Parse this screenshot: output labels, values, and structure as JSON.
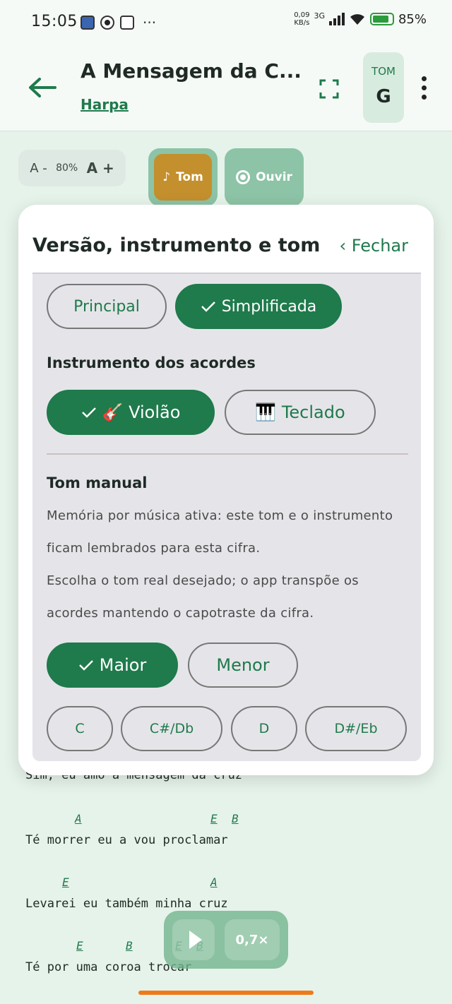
{
  "status_bar": {
    "time": "15:05",
    "more": "···",
    "net_speed_value": "0,09",
    "net_speed_unit": "KB/s",
    "network": "3G",
    "battery": "85%"
  },
  "header": {
    "title": "A Mensagem da C...",
    "subtitle": "Harpa",
    "tom_label": "TOM",
    "tom_value": "G"
  },
  "toolbar": {
    "font_decrease": "A -",
    "font_size": "80%",
    "font_increase": "A +",
    "tom_button": "Tom",
    "tom_glyph": "♪",
    "listen_button": "Ouvir"
  },
  "panel": {
    "title": "Versão, instrumento e tom",
    "close": "‹  Fechar",
    "versions": [
      {
        "label": "Principal",
        "selected": false
      },
      {
        "label": "Simplificada",
        "selected": true
      }
    ],
    "instrument_heading": "Instrumento dos acordes",
    "instruments": [
      {
        "label": "🎸 Violão",
        "selected": true
      },
      {
        "label": "🎹 Teclado",
        "selected": false
      }
    ],
    "manual_heading": "Tom manual",
    "paragraph1": "Memória por música ativa: este tom e o instrumento ficam lembrados para esta cifra.",
    "paragraph2": "Escolha o tom real desejado; o app transpõe os acordes mantendo o capotraste da cifra.",
    "modes": [
      {
        "label": "Maior",
        "selected": true
      },
      {
        "label": "Menor",
        "selected": false
      }
    ],
    "keys": [
      "C",
      "C#/Db",
      "D",
      "D#/Eb"
    ]
  },
  "lyrics": {
    "line0": "Sim, eu amo a mensagem da cruz",
    "line1_chords": [
      "A",
      "E",
      "B"
    ],
    "line1": "Té morrer eu a vou proclamar",
    "line2_chords": [
      "E",
      "A"
    ],
    "line2": "Levarei eu também minha cruz",
    "line3_chords": [
      "E",
      "B",
      "E",
      "B"
    ],
    "line3": "Té por uma coroa trocar"
  },
  "player": {
    "speed": "0,7×"
  },
  "colors": {
    "accent": "#1f7a4c",
    "tom_button": "#c48f2d",
    "content_bg": "#e6f3ea"
  }
}
